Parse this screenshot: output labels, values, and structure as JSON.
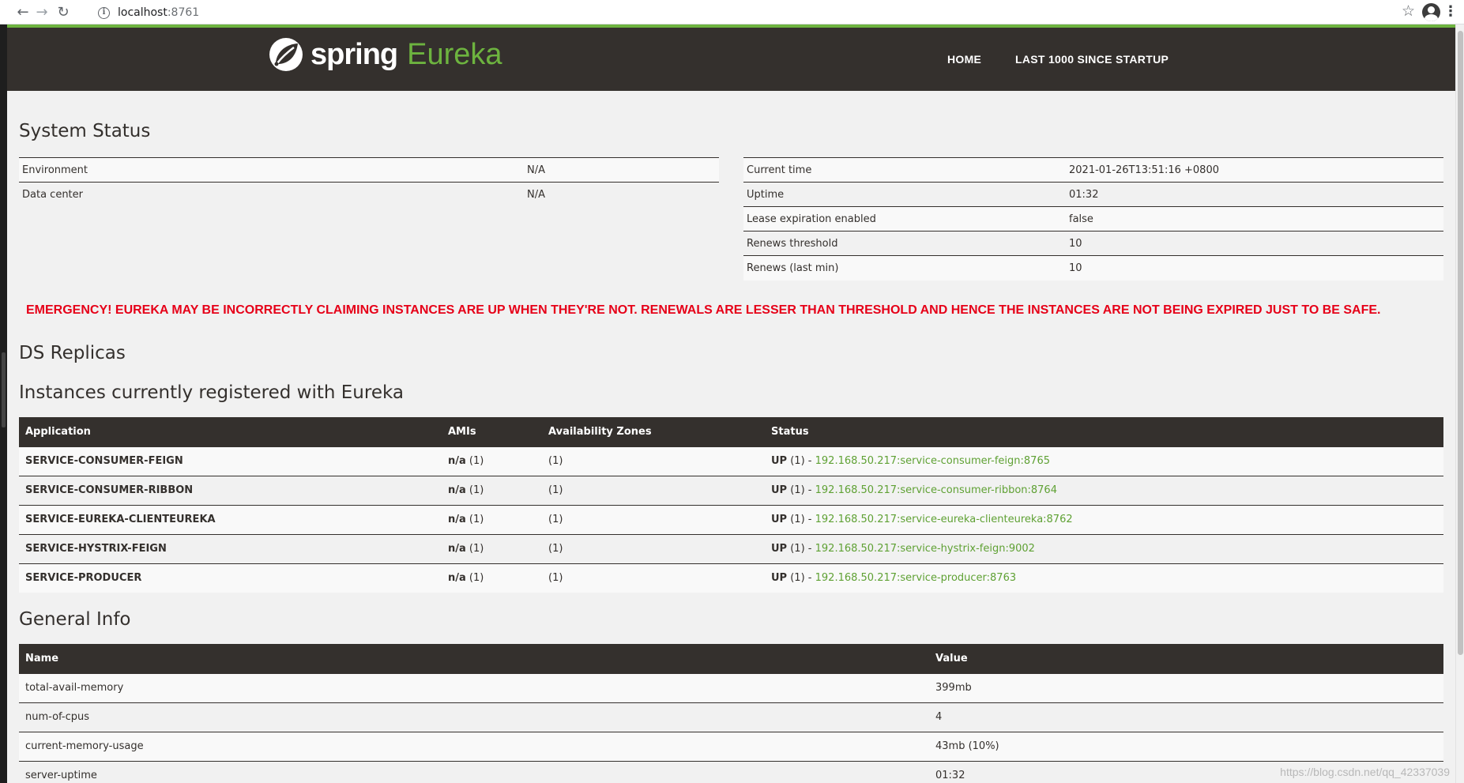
{
  "browser": {
    "url_host": "localhost",
    "url_port": ":8761"
  },
  "navbar": {
    "brand_spring": "spring",
    "brand_eureka": "Eureka",
    "links": [
      "HOME",
      "LAST 1000 SINCE STARTUP"
    ]
  },
  "system_status": {
    "title": "System Status",
    "left": [
      {
        "label": "Environment",
        "value": "N/A"
      },
      {
        "label": "Data center",
        "value": "N/A"
      }
    ],
    "right": [
      {
        "label": "Current time",
        "value": "2021-01-26T13:51:16 +0800"
      },
      {
        "label": "Uptime",
        "value": "01:32"
      },
      {
        "label": "Lease expiration enabled",
        "value": "false"
      },
      {
        "label": "Renews threshold",
        "value": "10"
      },
      {
        "label": "Renews (last min)",
        "value": "10"
      }
    ]
  },
  "emergency": "EMERGENCY! EUREKA MAY BE INCORRECTLY CLAIMING INSTANCES ARE UP WHEN THEY'RE NOT. RENEWALS ARE LESSER THAN THRESHOLD AND HENCE THE INSTANCES ARE NOT BEING EXPIRED JUST TO BE SAFE.",
  "ds_replicas": {
    "title": "DS Replicas"
  },
  "instances": {
    "title": "Instances currently registered with Eureka",
    "headers": [
      "Application",
      "AMIs",
      "Availability Zones",
      "Status"
    ],
    "rows": [
      {
        "app": "SERVICE-CONSUMER-FEIGN",
        "ami": "n/a",
        "ami_count": "(1)",
        "zones": "(1)",
        "status": "UP",
        "status_count": "(1) -",
        "instance": "192.168.50.217:service-consumer-feign:8765"
      },
      {
        "app": "SERVICE-CONSUMER-RIBBON",
        "ami": "n/a",
        "ami_count": "(1)",
        "zones": "(1)",
        "status": "UP",
        "status_count": "(1) -",
        "instance": "192.168.50.217:service-consumer-ribbon:8764"
      },
      {
        "app": "SERVICE-EUREKA-CLIENTEUREKA",
        "ami": "n/a",
        "ami_count": "(1)",
        "zones": "(1)",
        "status": "UP",
        "status_count": "(1) -",
        "instance": "192.168.50.217:service-eureka-clienteureka:8762"
      },
      {
        "app": "SERVICE-HYSTRIX-FEIGN",
        "ami": "n/a",
        "ami_count": "(1)",
        "zones": "(1)",
        "status": "UP",
        "status_count": "(1) -",
        "instance": "192.168.50.217:service-hystrix-feign:9002"
      },
      {
        "app": "SERVICE-PRODUCER",
        "ami": "n/a",
        "ami_count": "(1)",
        "zones": "(1)",
        "status": "UP",
        "status_count": "(1) -",
        "instance": "192.168.50.217:service-producer:8763"
      }
    ]
  },
  "general_info": {
    "title": "General Info",
    "headers": [
      "Name",
      "Value"
    ],
    "rows": [
      {
        "name": "total-avail-memory",
        "value": "399mb"
      },
      {
        "name": "num-of-cpus",
        "value": "4"
      },
      {
        "name": "current-memory-usage",
        "value": "43mb (10%)"
      },
      {
        "name": "server-uptime",
        "value": "01:32"
      }
    ]
  },
  "watermark": "https://blog.csdn.net/qq_42337039",
  "colors": {
    "brand_green": "#6db33f",
    "navbar_bg": "#34302d",
    "emergency_red": "#e60018",
    "link_green": "#5fa134"
  },
  "icons": [
    "back-arrow-icon",
    "forward-arrow-icon",
    "reload-icon",
    "info-icon",
    "star-icon",
    "account-icon",
    "menu-icon",
    "spring-leaf-icon"
  ]
}
